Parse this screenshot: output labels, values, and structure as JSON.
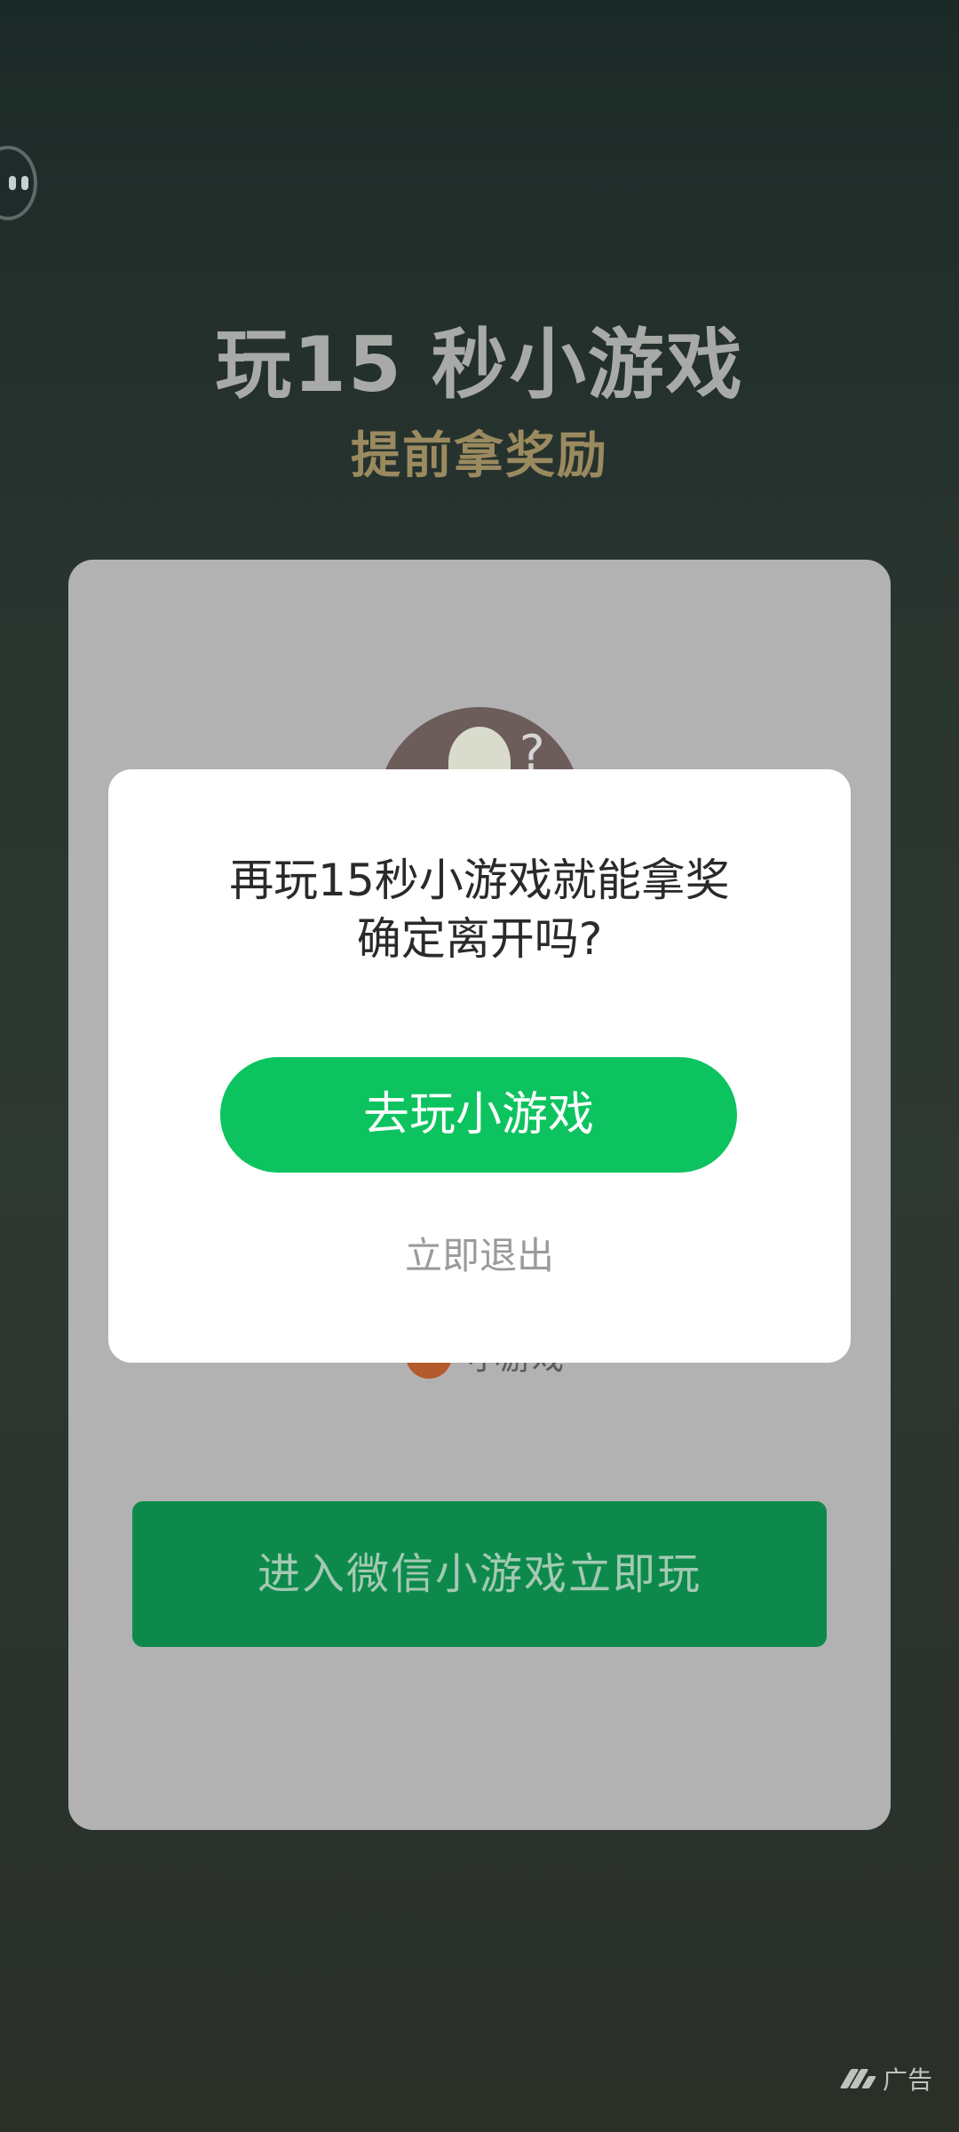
{
  "header": {
    "title": "玩15 秒小游戏",
    "subtitle": "提前拿奖励"
  },
  "card": {
    "game_label": "小游戏",
    "enter_button_label": "进入微信小游戏立即玩"
  },
  "modal": {
    "line1": "再玩15秒小游戏就能拿奖",
    "line2": "确定离开吗?",
    "primary_button_label": "去玩小游戏",
    "secondary_link_label": "立即退出"
  },
  "footer": {
    "ad_label": "广告"
  },
  "colors": {
    "primary_green": "#0dc35f",
    "card_button_green": "#0d8a4b",
    "subtitle_gold": "#9b8a5f"
  },
  "icons": {
    "top_left": "assistant-face-icon",
    "ad": "ad-brand-icon"
  }
}
